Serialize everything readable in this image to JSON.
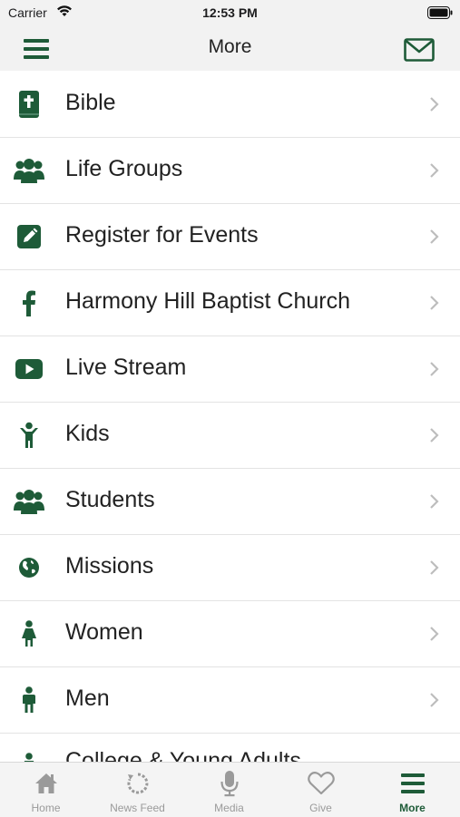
{
  "status": {
    "carrier": "Carrier",
    "time": "12:53 PM"
  },
  "nav": {
    "title": "More"
  },
  "items": [
    {
      "label": "Bible",
      "icon": "bible-icon"
    },
    {
      "label": "Life Groups",
      "icon": "group-icon"
    },
    {
      "label": "Register for Events",
      "icon": "edit-icon"
    },
    {
      "label": "Harmony Hill Baptist Church",
      "icon": "facebook-icon"
    },
    {
      "label": "Live Stream",
      "icon": "youtube-icon"
    },
    {
      "label": "Kids",
      "icon": "child-icon"
    },
    {
      "label": "Students",
      "icon": "group-icon"
    },
    {
      "label": "Missions",
      "icon": "globe-icon"
    },
    {
      "label": "Women",
      "icon": "female-icon"
    },
    {
      "label": "Men",
      "icon": "male-icon"
    },
    {
      "label": "College & Young Adults",
      "icon": "person-icon"
    }
  ],
  "tabs": [
    {
      "label": "Home",
      "icon": "home-icon"
    },
    {
      "label": "News Feed",
      "icon": "refresh-icon"
    },
    {
      "label": "Media",
      "icon": "microphone-icon"
    },
    {
      "label": "Give",
      "icon": "heart-icon"
    },
    {
      "label": "More",
      "icon": "menu-icon",
      "active": true
    }
  ],
  "colors": {
    "accent": "#1e5b38",
    "inactive": "#9a9a9a"
  }
}
